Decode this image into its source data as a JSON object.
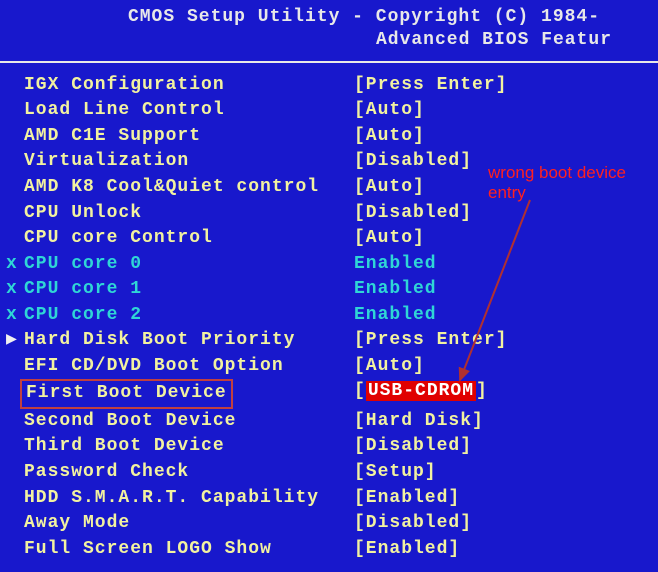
{
  "header": {
    "line1": "CMOS Setup Utility - Copyright (C) 1984-",
    "line2": "Advanced BIOS Featur"
  },
  "rows": [
    {
      "marker": "",
      "label": "IGX Configuration",
      "value": "[Press Enter]",
      "style": "normal"
    },
    {
      "marker": "",
      "label": "Load Line Control",
      "value": "[Auto]",
      "style": "normal"
    },
    {
      "marker": "",
      "label": "AMD C1E Support",
      "value": "[Auto]",
      "style": "normal"
    },
    {
      "marker": "",
      "label": "Virtualization",
      "value": "[Disabled]",
      "style": "normal"
    },
    {
      "marker": "",
      "label": "AMD K8 Cool&Quiet control",
      "value": "[Auto]",
      "style": "normal"
    },
    {
      "marker": "",
      "label": "CPU Unlock",
      "value": "[Disabled]",
      "style": "normal"
    },
    {
      "marker": "",
      "label": "CPU core Control",
      "value": "[Auto]",
      "style": "normal"
    },
    {
      "marker": "x",
      "label": "CPU core 0",
      "value": " Enabled",
      "style": "teal"
    },
    {
      "marker": "x",
      "label": "CPU core 1",
      "value": " Enabled",
      "style": "teal"
    },
    {
      "marker": "x",
      "label": "CPU core 2",
      "value": " Enabled",
      "style": "teal"
    },
    {
      "marker": "▶",
      "label": "Hard Disk Boot Priority",
      "value": "[Press Enter]",
      "style": "normal",
      "markerStyle": "arrow"
    },
    {
      "marker": "",
      "label": "EFI CD/DVD Boot Option",
      "value": "[Auto]",
      "style": "normal"
    },
    {
      "marker": "",
      "label": "First Boot Device",
      "value_pre": "[",
      "value_hl": "USB-CDROM",
      "value_post": "]",
      "style": "normal",
      "highlightLabel": true,
      "highlightValue": true
    },
    {
      "marker": "",
      "label": "Second Boot Device",
      "value": "[Hard Disk]",
      "style": "normal"
    },
    {
      "marker": "",
      "label": "Third Boot Device",
      "value": "[Disabled]",
      "style": "normal"
    },
    {
      "marker": "",
      "label": "Password Check",
      "value": "[Setup]",
      "style": "normal"
    },
    {
      "marker": "",
      "label": "HDD S.M.A.R.T. Capability",
      "value": "[Enabled]",
      "style": "normal"
    },
    {
      "marker": "",
      "label": "Away Mode",
      "value": "[Disabled]",
      "style": "normal"
    },
    {
      "marker": "",
      "label": "Full Screen LOGO Show",
      "value": "[Enabled]",
      "style": "normal"
    }
  ],
  "annotation": {
    "line1": "wrong boot device",
    "line2": "entry"
  }
}
